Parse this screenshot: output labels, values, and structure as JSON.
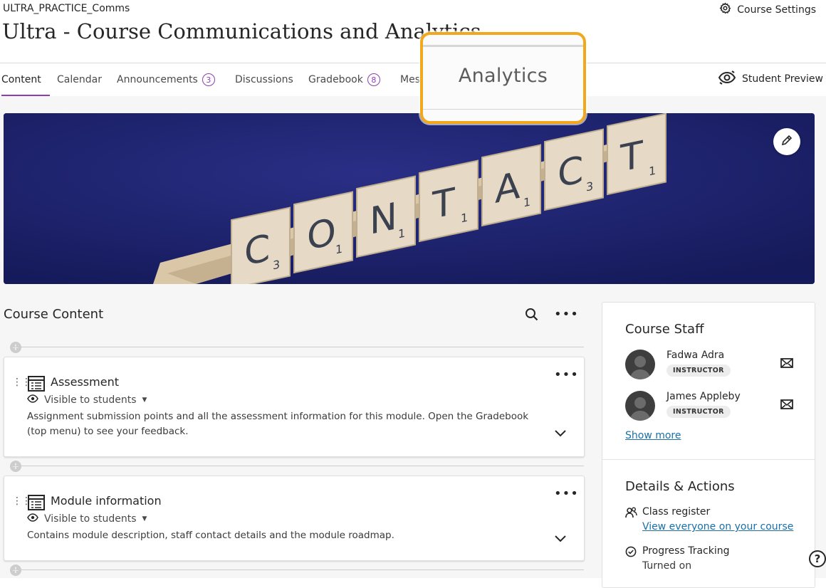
{
  "header": {
    "course_id": "ULTRA_PRACTICE_Comms",
    "course_title": "Ultra - Course Communications and Analytics",
    "settings_label": "Course Settings"
  },
  "nav": {
    "tabs": [
      {
        "label": "Content"
      },
      {
        "label": "Calendar"
      },
      {
        "label": "Announcements",
        "badge": "3"
      },
      {
        "label": "Discussions"
      },
      {
        "label": "Gradebook",
        "badge": "8"
      },
      {
        "label": "Mes"
      }
    ],
    "student_preview": "Student Preview"
  },
  "callout": {
    "label": "Analytics",
    "border_color": "#f2a81d"
  },
  "banner": {
    "tiles": [
      {
        "letter": "C",
        "sub": "3"
      },
      {
        "letter": "O",
        "sub": "1"
      },
      {
        "letter": "N",
        "sub": "1"
      },
      {
        "letter": "T",
        "sub": "1"
      },
      {
        "letter": "A",
        "sub": "1"
      },
      {
        "letter": "C",
        "sub": "3"
      },
      {
        "letter": "T",
        "sub": "1"
      }
    ]
  },
  "course_content": {
    "heading": "Course Content",
    "items": [
      {
        "title": "Assessment",
        "visibility": "Visible to students",
        "description": "Assignment submission points and all the assessment information for this module. Open the Gradebook (top menu) to see your feedback."
      },
      {
        "title": "Module information",
        "visibility": "Visible to students",
        "description": "Contains module description, staff contact details and the module roadmap."
      }
    ]
  },
  "sidebar": {
    "staff_heading": "Course Staff",
    "staff": [
      {
        "name": "Fadwa Adra",
        "role": "INSTRUCTOR"
      },
      {
        "name": "James Appleby",
        "role": "INSTRUCTOR"
      }
    ],
    "show_more": "Show more",
    "details_heading": "Details & Actions",
    "class_register": {
      "title": "Class register",
      "link": "View everyone on your course"
    },
    "progress": {
      "title": "Progress Tracking",
      "status": "Turned on"
    }
  },
  "colors": {
    "accent": "#8f3cb5",
    "link": "#1a6fa9",
    "banner": "#1c2272"
  }
}
